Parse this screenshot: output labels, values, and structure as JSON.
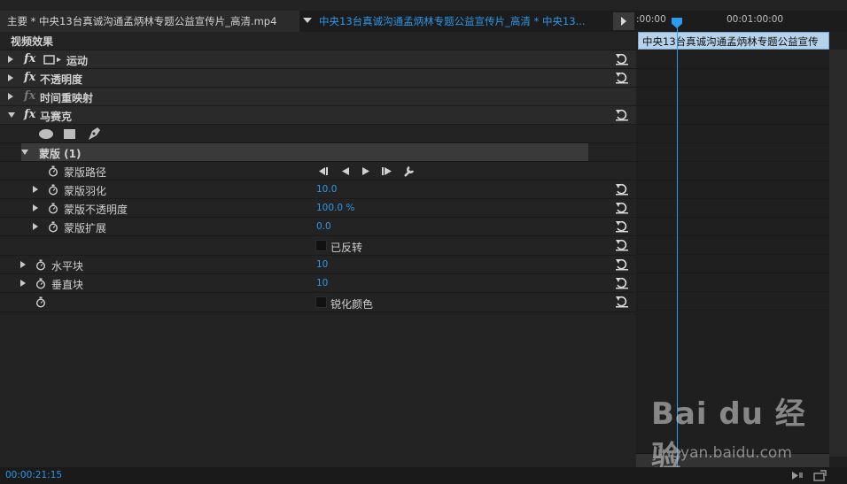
{
  "tabs": {
    "master_label": "主要 * 中央13台真诚沟通孟炳林专题公益宣传片_高清.mp4",
    "sequence_label": "中央13台真诚沟通孟炳林专题公益宣传片_高清 * 中央13..."
  },
  "effects": {
    "section_title": "视频效果",
    "items": [
      {
        "label": "运动"
      },
      {
        "label": "不透明度"
      },
      {
        "label": "时间重映射"
      },
      {
        "label": "马赛克"
      }
    ]
  },
  "mask": {
    "title": "蒙版 (1)",
    "path_label": "蒙版路径",
    "properties": [
      {
        "label": "蒙版羽化",
        "value": "10.0"
      },
      {
        "label": "蒙版不透明度",
        "value": "100.0 %"
      },
      {
        "label": "蒙版扩展",
        "value": "0.0"
      }
    ],
    "inverted_label": "已反转"
  },
  "mosaic": {
    "horizontal_label": "水平块",
    "horizontal_value": "10",
    "vertical_label": "垂直块",
    "vertical_value": "10",
    "sharpen_label": "锐化颜色"
  },
  "timeline": {
    "tc_start": ":00:00",
    "tc_mark": "00:01:00:00",
    "clip_label": "中央13台真诚沟通孟炳林专题公益宣传"
  },
  "status": {
    "timecode": "00:00:21:15"
  },
  "watermark": {
    "brand": "Bai du 经验",
    "url": "jingyan.baidu.com"
  },
  "colors": {
    "accent": "#2e96e6",
    "clip": "#b6d2ea"
  }
}
